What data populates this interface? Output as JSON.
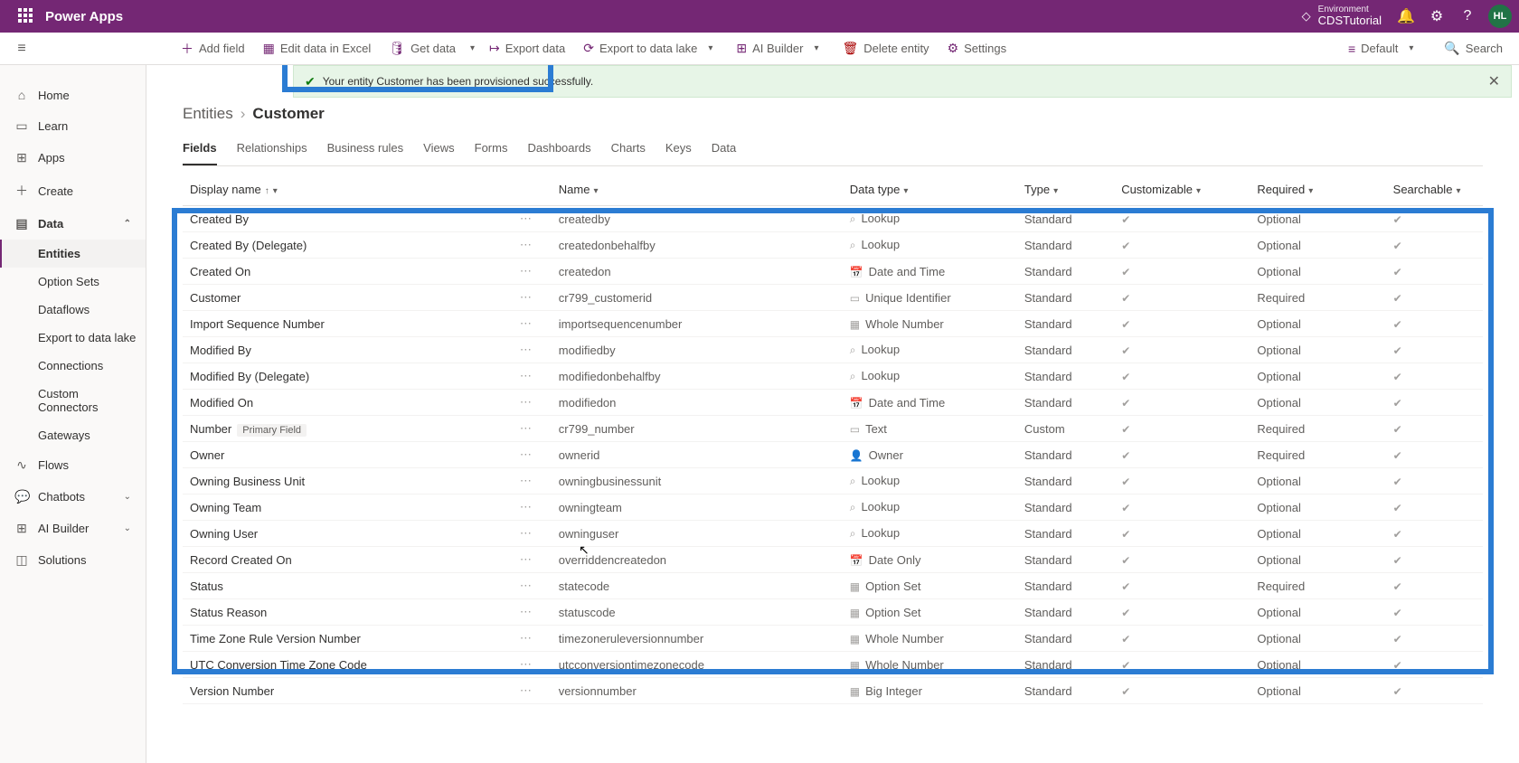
{
  "header": {
    "brand": "Power Apps",
    "env_label": "Environment",
    "env_value": "CDSTutorial",
    "avatar": "HL"
  },
  "commandBar": {
    "addField": "Add field",
    "editExcel": "Edit data in Excel",
    "getData": "Get data",
    "exportData": "Export data",
    "exportLake": "Export to data lake",
    "aiBuilder": "AI Builder",
    "deleteEntity": "Delete entity",
    "settings": "Settings",
    "viewMode": "Default",
    "search": "Search"
  },
  "alert": {
    "message": "Your entity Customer has been provisioned successfully."
  },
  "nav": {
    "home": "Home",
    "learn": "Learn",
    "apps": "Apps",
    "create": "Create",
    "data": "Data",
    "entities": "Entities",
    "optionSets": "Option Sets",
    "dataflows": "Dataflows",
    "exportLake": "Export to data lake",
    "connections": "Connections",
    "customConnectors": "Custom Connectors",
    "gateways": "Gateways",
    "flows": "Flows",
    "chatbots": "Chatbots",
    "aiBuilder": "AI Builder",
    "solutions": "Solutions"
  },
  "breadcrumb": {
    "root": "Entities",
    "leaf": "Customer"
  },
  "tabs": [
    "Fields",
    "Relationships",
    "Business rules",
    "Views",
    "Forms",
    "Dashboards",
    "Charts",
    "Keys",
    "Data"
  ],
  "columns": {
    "display": "Display name",
    "name": "Name",
    "dataType": "Data type",
    "type": "Type",
    "customizable": "Customizable",
    "required": "Required",
    "searchable": "Searchable"
  },
  "rows": [
    {
      "display": "Created By",
      "name": "createdby",
      "dt": "Lookup",
      "type": "Standard",
      "req": "Optional",
      "primary": false
    },
    {
      "display": "Created By (Delegate)",
      "name": "createdonbehalfby",
      "dt": "Lookup",
      "type": "Standard",
      "req": "Optional",
      "primary": false
    },
    {
      "display": "Created On",
      "name": "createdon",
      "dt": "Date and Time",
      "type": "Standard",
      "req": "Optional",
      "primary": false
    },
    {
      "display": "Customer",
      "name": "cr799_customerid",
      "dt": "Unique Identifier",
      "type": "Standard",
      "req": "Required",
      "primary": false
    },
    {
      "display": "Import Sequence Number",
      "name": "importsequencenumber",
      "dt": "Whole Number",
      "type": "Standard",
      "req": "Optional",
      "primary": false
    },
    {
      "display": "Modified By",
      "name": "modifiedby",
      "dt": "Lookup",
      "type": "Standard",
      "req": "Optional",
      "primary": false
    },
    {
      "display": "Modified By (Delegate)",
      "name": "modifiedonbehalfby",
      "dt": "Lookup",
      "type": "Standard",
      "req": "Optional",
      "primary": false
    },
    {
      "display": "Modified On",
      "name": "modifiedon",
      "dt": "Date and Time",
      "type": "Standard",
      "req": "Optional",
      "primary": false
    },
    {
      "display": "Number",
      "name": "cr799_number",
      "dt": "Text",
      "type": "Custom",
      "req": "Required",
      "primary": true
    },
    {
      "display": "Owner",
      "name": "ownerid",
      "dt": "Owner",
      "type": "Standard",
      "req": "Required",
      "primary": false
    },
    {
      "display": "Owning Business Unit",
      "name": "owningbusinessunit",
      "dt": "Lookup",
      "type": "Standard",
      "req": "Optional",
      "primary": false
    },
    {
      "display": "Owning Team",
      "name": "owningteam",
      "dt": "Lookup",
      "type": "Standard",
      "req": "Optional",
      "primary": false
    },
    {
      "display": "Owning User",
      "name": "owninguser",
      "dt": "Lookup",
      "type": "Standard",
      "req": "Optional",
      "primary": false
    },
    {
      "display": "Record Created On",
      "name": "overriddencreatedon",
      "dt": "Date Only",
      "type": "Standard",
      "req": "Optional",
      "primary": false
    },
    {
      "display": "Status",
      "name": "statecode",
      "dt": "Option Set",
      "type": "Standard",
      "req": "Required",
      "primary": false
    },
    {
      "display": "Status Reason",
      "name": "statuscode",
      "dt": "Option Set",
      "type": "Standard",
      "req": "Optional",
      "primary": false
    },
    {
      "display": "Time Zone Rule Version Number",
      "name": "timezoneruleversionnumber",
      "dt": "Whole Number",
      "type": "Standard",
      "req": "Optional",
      "primary": false
    },
    {
      "display": "UTC Conversion Time Zone Code",
      "name": "utcconversiontimezonecode",
      "dt": "Whole Number",
      "type": "Standard",
      "req": "Optional",
      "primary": false
    },
    {
      "display": "Version Number",
      "name": "versionnumber",
      "dt": "Big Integer",
      "type": "Standard",
      "req": "Optional",
      "primary": false
    }
  ],
  "primaryBadge": "Primary Field",
  "dtIcons": {
    "Lookup": "⌕",
    "Date and Time": "📅",
    "Unique Identifier": "▭",
    "Whole Number": "▦",
    "Text": "▭",
    "Owner": "👤",
    "Date Only": "📅",
    "Option Set": "▦",
    "Big Integer": "▦"
  }
}
